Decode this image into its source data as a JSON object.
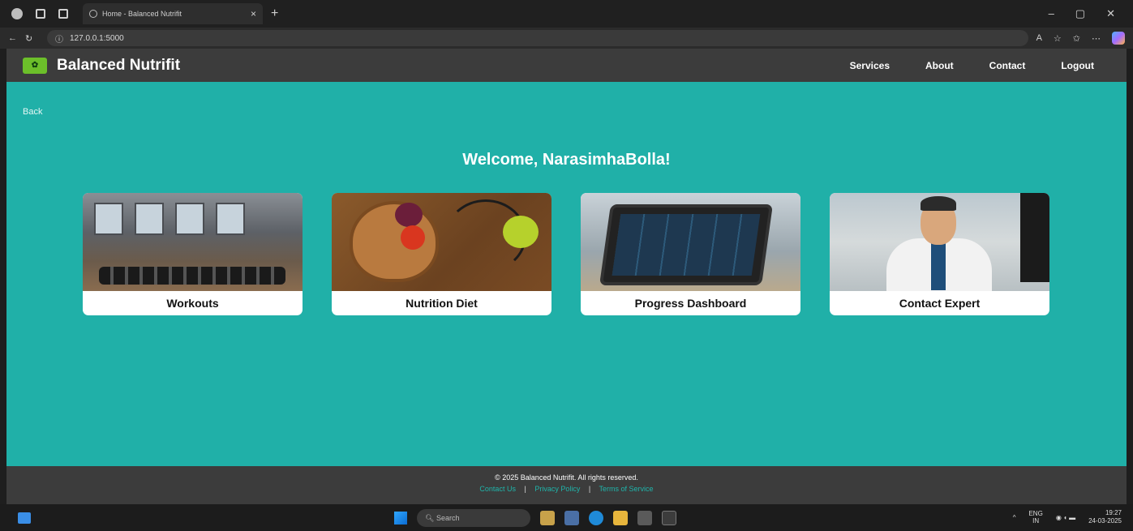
{
  "browser": {
    "tab_title": "Home - Balanced Nutrifit",
    "tab_close": "×",
    "new_tab": "+",
    "url": "127.0.0.1:5000",
    "window_controls": [
      "–",
      "▢",
      "✕"
    ]
  },
  "header": {
    "brand": "Balanced Nutrifit",
    "nav": [
      "Services",
      "About",
      "Contact",
      "Logout"
    ]
  },
  "main": {
    "back": "Back",
    "welcome": "Welcome, NarasimhaBolla!",
    "cards": [
      {
        "label": "Workouts"
      },
      {
        "label": "Nutrition Diet"
      },
      {
        "label": "Progress Dashboard"
      },
      {
        "label": "Contact Expert"
      }
    ]
  },
  "footer": {
    "copyright": "© 2025 Balanced Nutrifit. All rights reserved.",
    "links": [
      "Contact Us",
      "Privacy Policy",
      "Terms of Service"
    ],
    "separator": "|"
  },
  "taskbar": {
    "search_placeholder": "Search",
    "lang_top": "ENG",
    "lang_bottom": "IN",
    "time": "19:27",
    "date": "24-03-2025"
  },
  "colors": {
    "main_bg": "#20b0a8",
    "header_bg": "#3c3c3c",
    "link_accent": "#1fb5ab"
  }
}
